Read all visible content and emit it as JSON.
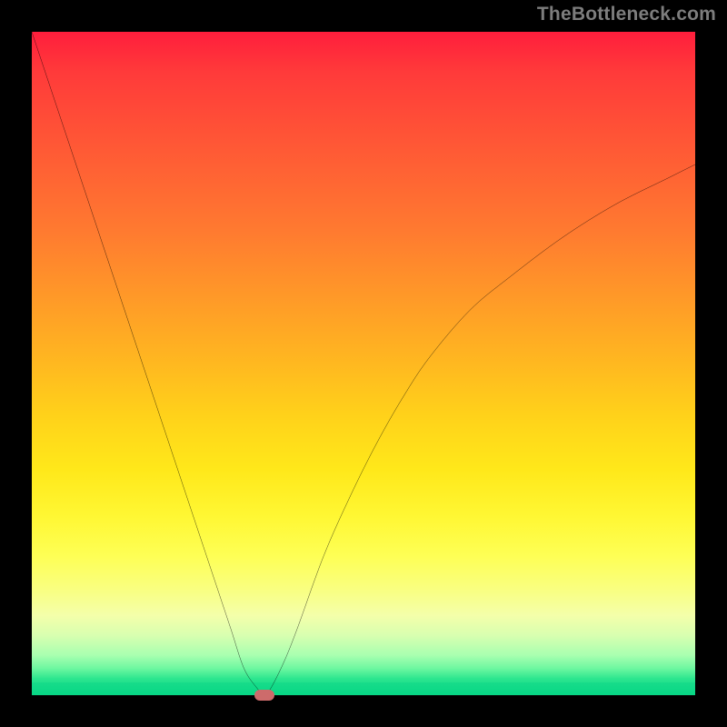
{
  "watermark": "TheBottleneck.com",
  "chart_data": {
    "type": "line",
    "title": "",
    "xlabel": "",
    "ylabel": "",
    "xlim": [
      0,
      100
    ],
    "ylim": [
      0,
      100
    ],
    "grid": false,
    "legend": false,
    "background": {
      "type": "vertical-gradient",
      "top_color": "#ff1e3c",
      "bottom_color": "#08d586"
    },
    "series": [
      {
        "name": "bottleneck-curve",
        "color": "#000000",
        "x": [
          0,
          4,
          8,
          12,
          16,
          20,
          24,
          28,
          30,
          32,
          34,
          35,
          36,
          38,
          40,
          44,
          48,
          52,
          56,
          60,
          66,
          72,
          80,
          88,
          96,
          100
        ],
        "y": [
          100,
          88,
          76,
          64,
          52,
          40,
          28,
          16,
          10,
          4,
          1,
          0,
          1,
          5,
          10,
          21,
          30,
          38,
          45,
          51,
          58,
          63,
          69,
          74,
          78,
          80
        ]
      }
    ],
    "marker": {
      "name": "optimum-point",
      "x": 35,
      "y": 0,
      "color": "#cd6b6b",
      "shape": "pill"
    }
  }
}
